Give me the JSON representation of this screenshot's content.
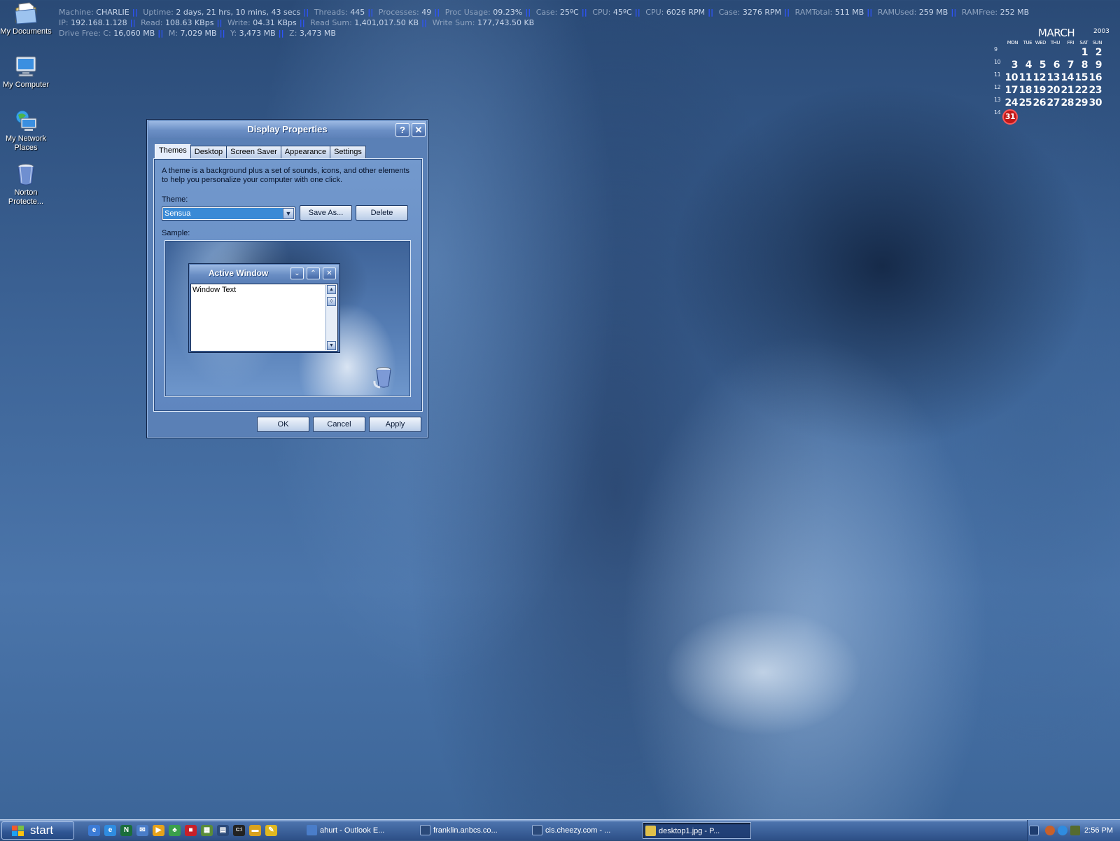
{
  "desktop_icons": [
    {
      "label": "My Documents",
      "icon": "my-documents-icon"
    },
    {
      "label": "My Computer",
      "icon": "my-computer-icon"
    },
    {
      "label": "My Network Places",
      "icon": "network-places-icon"
    },
    {
      "label": "Norton Protecte...",
      "icon": "recycle-bin-icon"
    }
  ],
  "stats": {
    "line1": [
      {
        "k": "Machine:",
        "v": "CHARLIE"
      },
      {
        "k": "Uptime:",
        "v": "2 days, 21 hrs, 10 mins, 43 secs"
      },
      {
        "k": "Threads:",
        "v": "445"
      },
      {
        "k": "Processes:",
        "v": "49"
      },
      {
        "k": "Proc Usage:",
        "v": "09.23%"
      },
      {
        "k": "Case:",
        "v": "25ºC"
      },
      {
        "k": "CPU:",
        "v": "45ºC"
      },
      {
        "k": "CPU:",
        "v": "6026 RPM"
      },
      {
        "k": "Case:",
        "v": "3276 RPM"
      },
      {
        "k": "RAMTotal:",
        "v": "511 MB"
      },
      {
        "k": "RAMUsed:",
        "v": "259 MB"
      },
      {
        "k": "RAMFree:",
        "v": "252 MB"
      }
    ],
    "line2": [
      {
        "k": "IP:",
        "v": "192.168.1.128"
      },
      {
        "k": "Read:",
        "v": "108.63 KBps"
      },
      {
        "k": "Write:",
        "v": "04.31 KBps"
      },
      {
        "k": "Read Sum:",
        "v": "1,401,017.50 KB"
      },
      {
        "k": "Write Sum:",
        "v": "177,743.50 KB"
      }
    ],
    "line3": [
      {
        "k": "Drive Free: C:",
        "v": "16,060 MB"
      },
      {
        "k": "M:",
        "v": "7,029 MB"
      },
      {
        "k": "Y:",
        "v": "3,473 MB"
      },
      {
        "k": "Z:",
        "v": "3,473 MB"
      }
    ]
  },
  "calendar": {
    "month": "MARCH",
    "year": "2003",
    "days_of_week": [
      "MON",
      "TUE",
      "WED",
      "THU",
      "FRI",
      "SAT",
      "SUN"
    ],
    "weeks": [
      {
        "wk": "9",
        "days": [
          "",
          "",
          "",
          "",
          "",
          "1",
          "2"
        ]
      },
      {
        "wk": "10",
        "days": [
          "3",
          "4",
          "5",
          "6",
          "7",
          "8",
          "9"
        ]
      },
      {
        "wk": "11",
        "days": [
          "10",
          "11",
          "12",
          "13",
          "14",
          "15",
          "16"
        ]
      },
      {
        "wk": "12",
        "days": [
          "17",
          "18",
          "19",
          "20",
          "21",
          "22",
          "23"
        ]
      },
      {
        "wk": "13",
        "days": [
          "24",
          "25",
          "26",
          "27",
          "28",
          "29",
          "30"
        ]
      },
      {
        "wk": "14",
        "days": [
          "31",
          "",
          "",
          "",
          "",
          "",
          ""
        ]
      }
    ],
    "today": "31"
  },
  "dialog": {
    "title": "Display Properties",
    "help_label": "?",
    "close_label": "✕",
    "tabs": [
      "Themes",
      "Desktop",
      "Screen Saver",
      "Appearance",
      "Settings"
    ],
    "active_tab": "Themes",
    "description": "A theme is a background plus a set of sounds, icons, and other elements to help you personalize your computer with one click.",
    "theme_label": "Theme:",
    "theme_value": "Sensua",
    "save_as_label": "Save As...",
    "delete_label": "Delete",
    "sample_label": "Sample:",
    "sample_window": {
      "title": "Active Window",
      "min_label": "⌄",
      "max_label": "⌃",
      "close_label": "✕",
      "text": "Window Text"
    },
    "ok_label": "OK",
    "cancel_label": "Cancel",
    "apply_label": "Apply"
  },
  "taskbar": {
    "start_label": "start",
    "tasks": [
      {
        "label": "ahurt - Outlook E...",
        "icon": "outlook-express-icon",
        "active": false
      },
      {
        "label": "franklin.anbcs.co...",
        "icon": "terminal-icon",
        "active": false
      },
      {
        "label": "cis.cheezy.com - ...",
        "icon": "terminal-icon",
        "active": false
      },
      {
        "label": "desktop1.jpg - P...",
        "icon": "paint-icon",
        "active": true
      }
    ],
    "clock": "2:56 PM"
  }
}
